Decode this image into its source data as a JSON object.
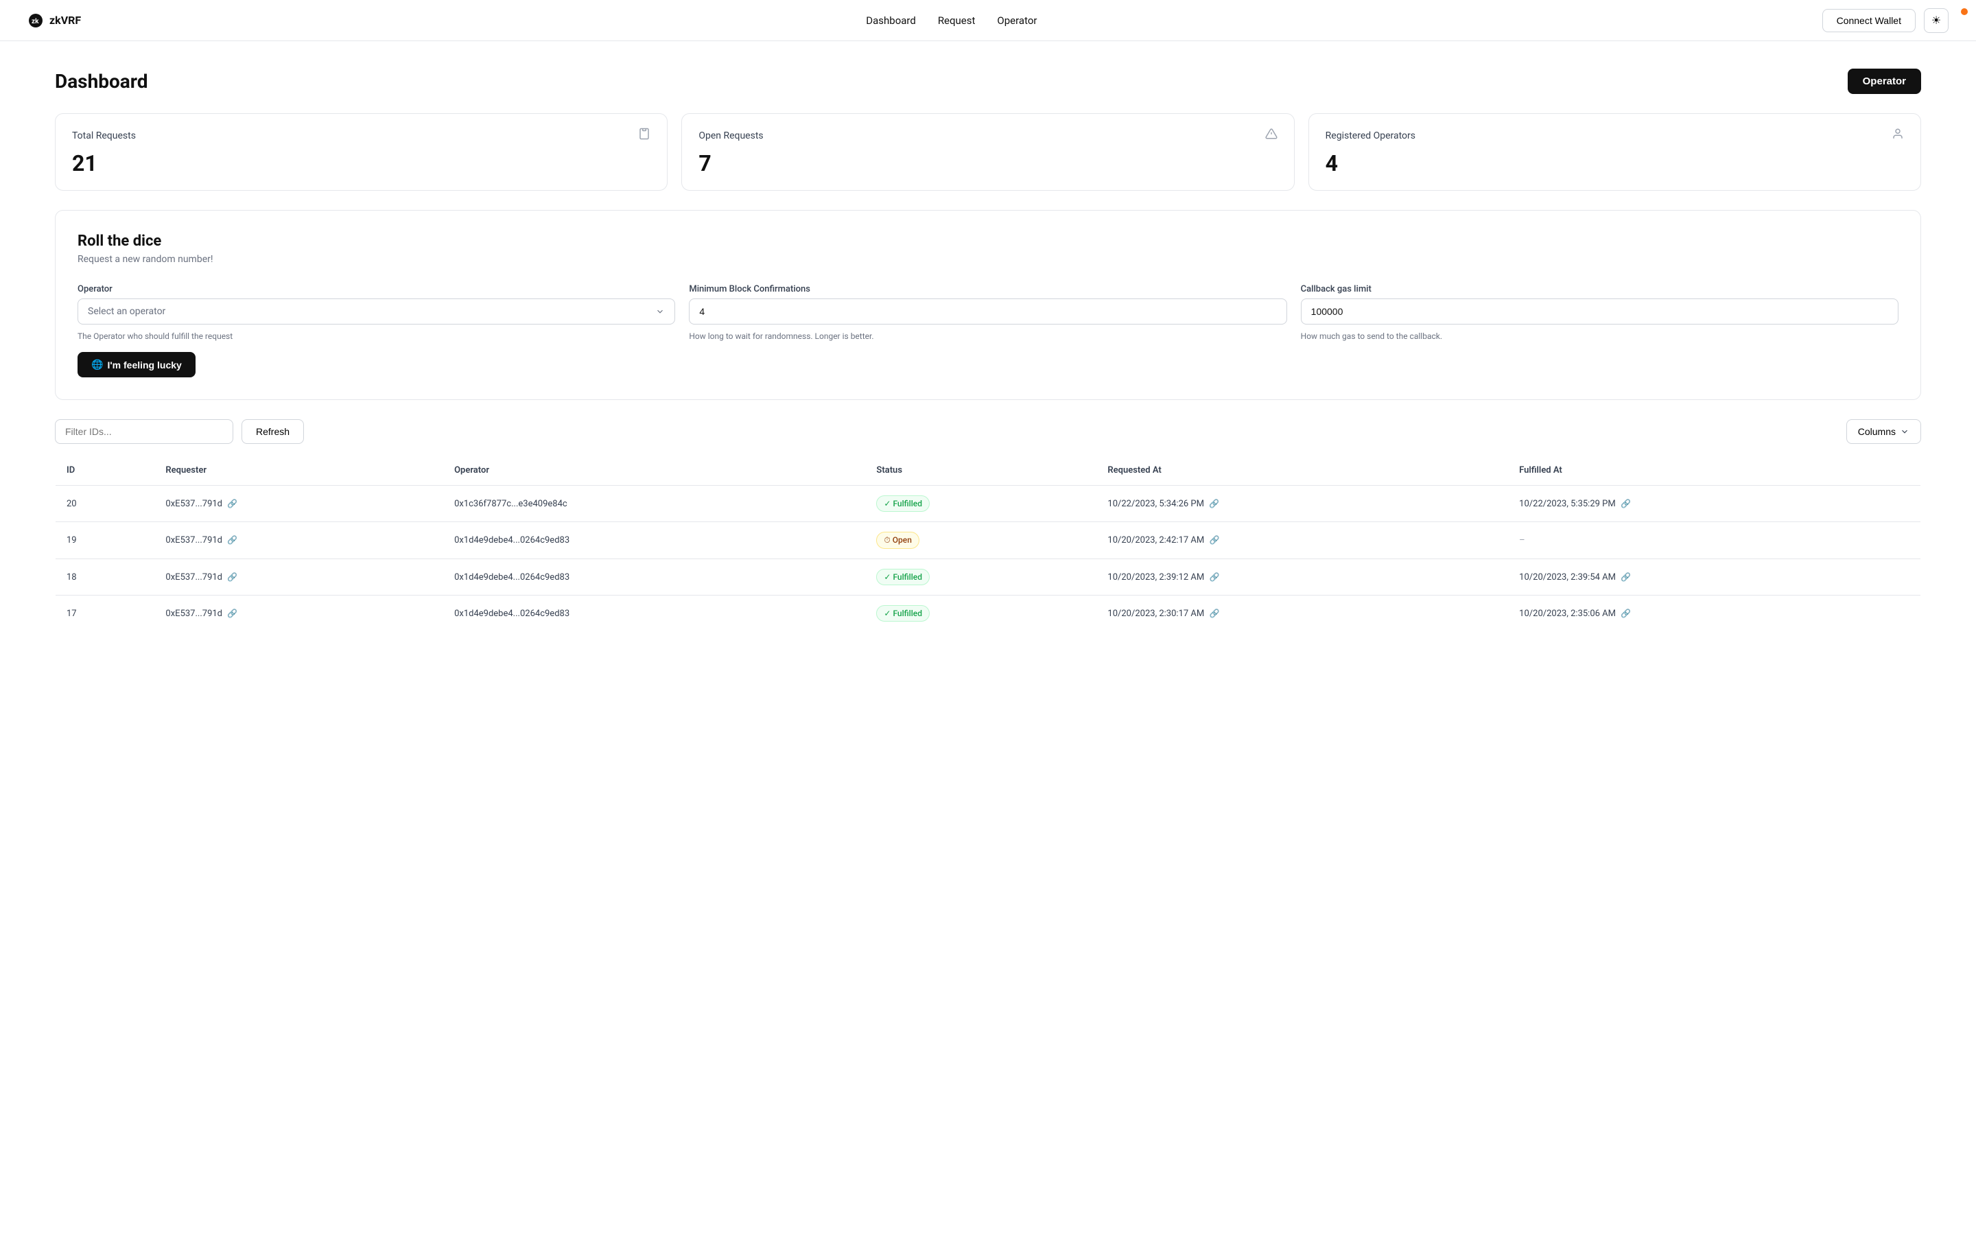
{
  "navbar": {
    "logo_text": "zkVRF",
    "nav_items": [
      {
        "label": "Dashboard",
        "href": "#"
      },
      {
        "label": "Request",
        "href": "#"
      },
      {
        "label": "Operator",
        "href": "#"
      }
    ],
    "connect_wallet_label": "Connect Wallet",
    "theme_icon": "☀"
  },
  "page": {
    "title": "Dashboard",
    "operator_button_label": "Operator"
  },
  "stats": [
    {
      "label": "Total Requests",
      "value": "21",
      "icon": "📋"
    },
    {
      "label": "Open Requests",
      "value": "7",
      "icon": "⚠"
    },
    {
      "label": "Registered Operators",
      "value": "4",
      "icon": "👤"
    }
  ],
  "roll_section": {
    "title": "Roll the dice",
    "subtitle": "Request a new random number!",
    "operator_field": {
      "label": "Operator",
      "placeholder": "Select an operator",
      "hint": "The Operator who should fulfill the request"
    },
    "min_confirmations_field": {
      "label": "Minimum Block Confirmations",
      "value": "4",
      "hint": "How long to wait for randomness. Longer is better."
    },
    "gas_limit_field": {
      "label": "Callback gas limit",
      "value": "100000",
      "hint": "How much gas to send to the callback."
    },
    "lucky_button_label": "I'm feeling lucky",
    "lucky_button_icon": "🌐"
  },
  "table": {
    "filter_placeholder": "Filter IDs...",
    "refresh_label": "Refresh",
    "columns_label": "Columns",
    "headers": [
      "ID",
      "Requester",
      "Operator",
      "Status",
      "Requested At",
      "Fulfilled At"
    ],
    "rows": [
      {
        "id": "20",
        "requester": "0xE537...791d",
        "operator": "0x1c36f7877c...e3e409e84c",
        "status": "Fulfilled",
        "status_type": "fulfilled",
        "requested_at": "10/22/2023, 5:34:26 PM",
        "fulfilled_at": "10/22/2023, 5:35:29 PM"
      },
      {
        "id": "19",
        "requester": "0xE537...791d",
        "operator": "0x1d4e9debe4...0264c9ed83",
        "status": "Open",
        "status_type": "open",
        "requested_at": "10/20/2023, 2:42:17 AM",
        "fulfilled_at": "–"
      },
      {
        "id": "18",
        "requester": "0xE537...791d",
        "operator": "0x1d4e9debe4...0264c9ed83",
        "status": "Fulfilled",
        "status_type": "fulfilled",
        "requested_at": "10/20/2023, 2:39:12 AM",
        "fulfilled_at": "10/20/2023, 2:39:54 AM"
      },
      {
        "id": "17",
        "requester": "0xE537...791d",
        "operator": "0x1d4e9debe4...0264c9ed83",
        "status": "Fulfilled",
        "status_type": "fulfilled",
        "requested_at": "10/20/2023, 2:30:17 AM",
        "fulfilled_at": "10/20/2023, 2:35:06 AM"
      }
    ]
  }
}
